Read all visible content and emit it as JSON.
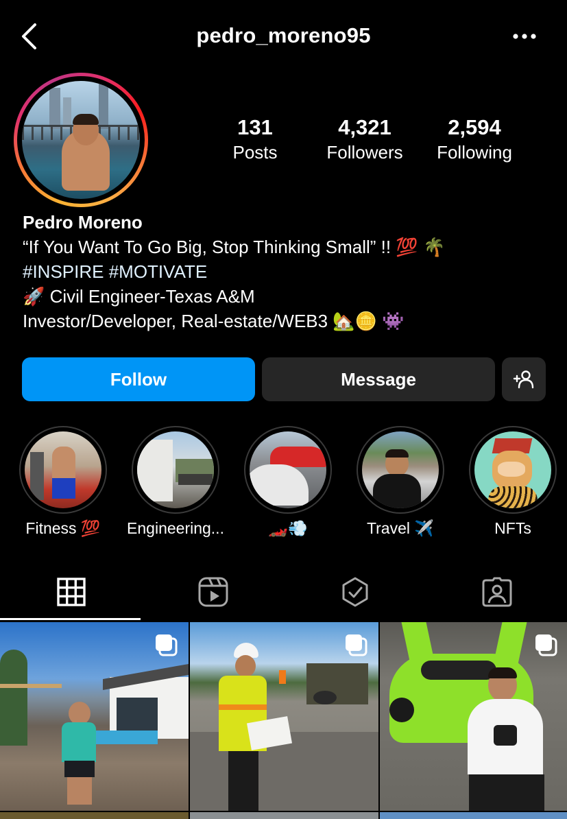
{
  "header": {
    "username": "pedro_moreno95"
  },
  "stats": {
    "posts": {
      "value": "131",
      "label": "Posts"
    },
    "followers": {
      "value": "4,321",
      "label": "Followers"
    },
    "following": {
      "value": "2,594",
      "label": "Following"
    }
  },
  "bio": {
    "name": "Pedro Moreno",
    "quote": "“If You Want To Go Big, Stop Thinking Small” !! 💯 🌴",
    "hashtags": "#INSPIRE #MOTIVATE",
    "role": "🚀  Civil Engineer-Texas A&M",
    "work": "Investor/Developer, Real-estate/WEB3 🏡🪙 👾"
  },
  "actions": {
    "follow_label": "Follow",
    "message_label": "Message"
  },
  "highlights": [
    {
      "label": "Fitness 💯"
    },
    {
      "label": "Engineering..."
    },
    {
      "label": "🏎️💨"
    },
    {
      "label": "Travel ✈️"
    },
    {
      "label": "NFTs"
    }
  ],
  "tabs": [
    "grid-icon",
    "reels-icon",
    "tagged-check-icon",
    "profile-tagged-icon"
  ],
  "colors": {
    "follow_button": "#0095f6",
    "secondary_button": "#262626",
    "background": "#000000"
  }
}
